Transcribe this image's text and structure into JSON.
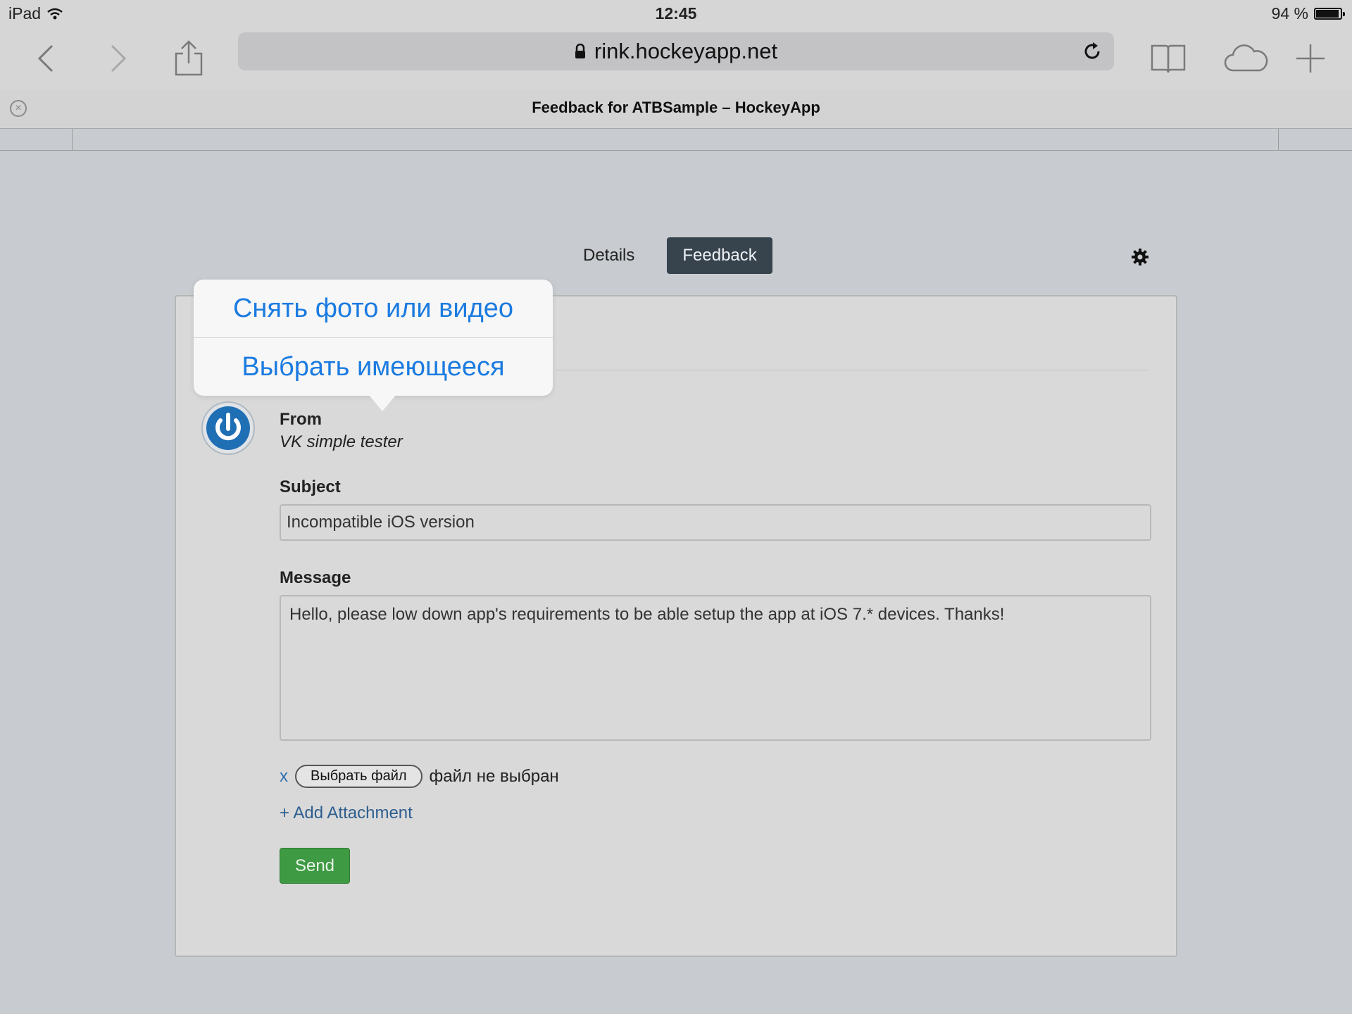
{
  "status": {
    "device": "iPad",
    "time": "12:45",
    "battery": "94 %",
    "battery_level": 0.94
  },
  "toolbar": {
    "url": "rink.hockeyapp.net"
  },
  "tab": {
    "title": "Feedback for ATBSample – HockeyApp"
  },
  "page": {
    "tabs": [
      {
        "label": "Details",
        "active": false
      },
      {
        "label": "Feedback",
        "active": true
      }
    ],
    "from_label": "From",
    "from_name": "VK simple tester",
    "subject_label": "Subject",
    "subject_value": "Incompatible iOS version",
    "message_label": "Message",
    "message_value": "Hello, please low down app's requirements to be able setup the app at iOS 7.* devices. Thanks!",
    "remove_attachment": "x",
    "choose_file_label": "Выбрать файл",
    "no_file_text": "файл не выбран",
    "add_attachment": "+ Add Attachment",
    "send_label": "Send"
  },
  "popover": {
    "take_photo": "Снять фото или видео",
    "choose_existing": "Выбрать имеющееся"
  },
  "colors": {
    "accent_blue": "#1b7be0",
    "send_green": "#3f9a44",
    "active_tab": "#37434d"
  }
}
